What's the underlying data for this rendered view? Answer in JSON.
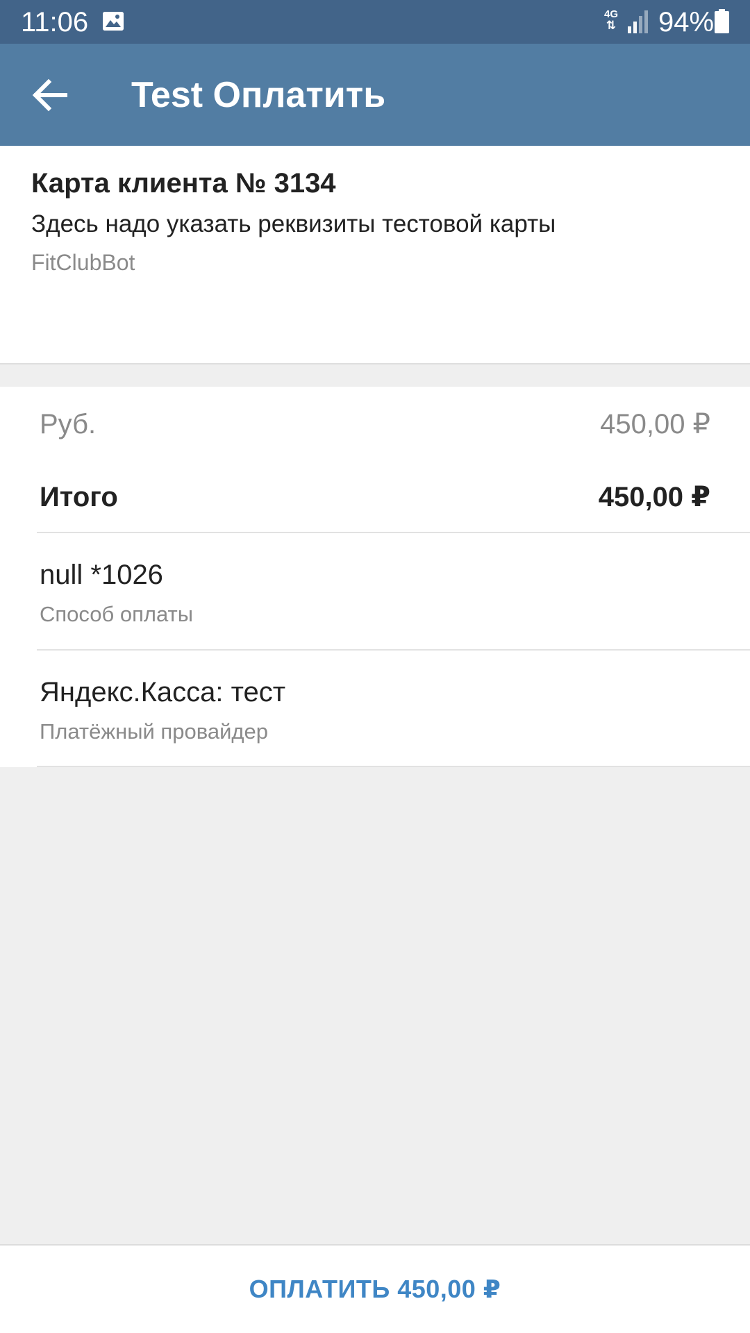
{
  "status_bar": {
    "time": "11:06",
    "network": "4G",
    "battery": "94%",
    "icons": [
      "gallery-icon",
      "network-4g-icon",
      "signal-icon",
      "battery-icon"
    ]
  },
  "toolbar": {
    "title": "Test Оплатить",
    "back_icon": "arrow-left-icon"
  },
  "invoice": {
    "title": "Карта клиента № 3134",
    "description": "Здесь надо указать реквизиты тестовой карты",
    "bot": "FitClubBot"
  },
  "prices": {
    "item_label": "Руб.",
    "item_value": "450,00 ₽",
    "total_label": "Итого",
    "total_value": "450,00 ₽"
  },
  "payment_method": {
    "value": "null *1026",
    "label": "Способ оплаты"
  },
  "provider": {
    "value": "Яндекс.Касса: тест",
    "label": "Платёжный провайдер"
  },
  "pay_button": {
    "label": "ОПЛАТИТЬ 450,00 ₽"
  },
  "colors": {
    "status_bar": "#426489",
    "toolbar": "#527da3",
    "accent": "#3f86c5",
    "background": "#efefef"
  }
}
